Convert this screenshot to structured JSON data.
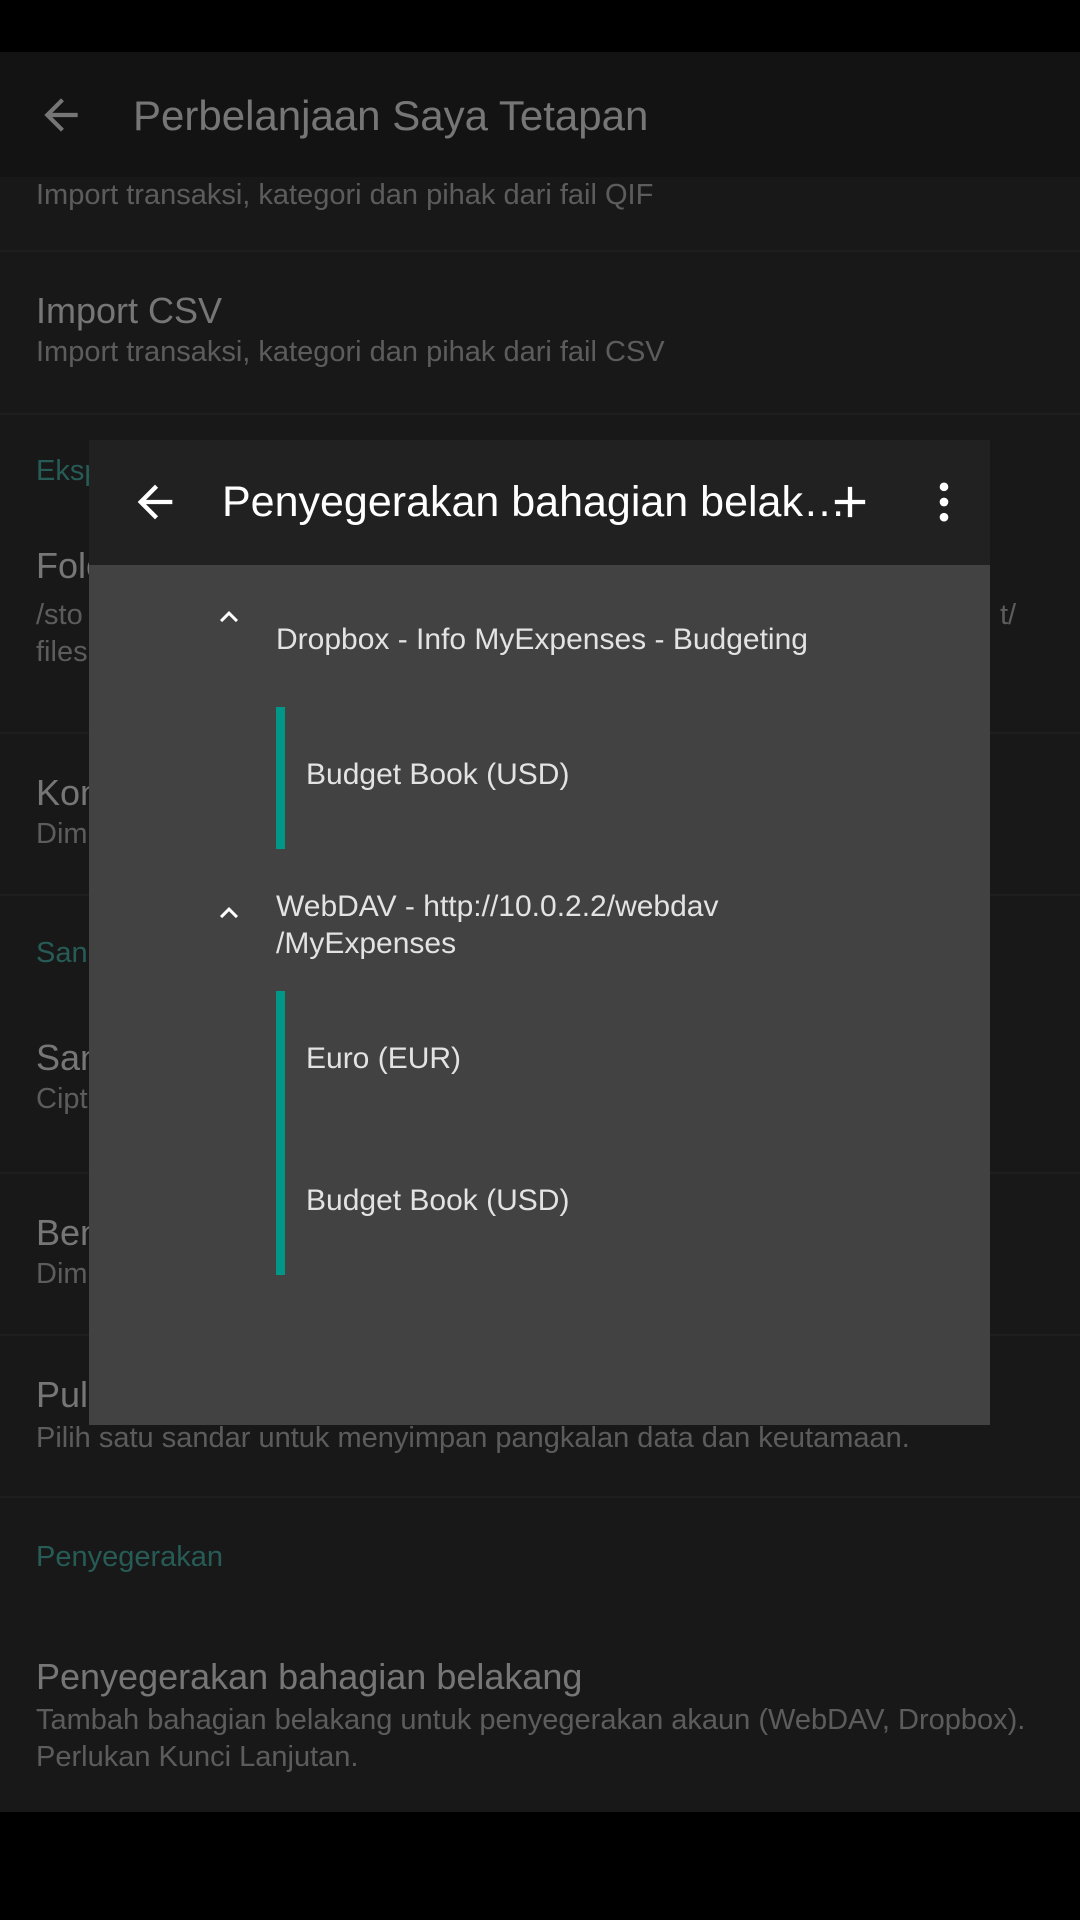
{
  "app_bar": {
    "title": "Perbelanjaan Saya Tetapan"
  },
  "settings": {
    "qif_summary": "Import transaksi, kategori dan pihak dari fail QIF",
    "csv_title": "Import CSV",
    "csv_summary": "Import transaksi, kategori dan pihak dari fail CSV",
    "export_category": "Eksp",
    "folder_title": "Folo",
    "folder_summary_line1": "/sto",
    "folder_summary_line2": "files",
    "folder_summary_right": "t/",
    "kon_title": "Kon",
    "kon_summary": "Dim",
    "san_category": "San",
    "san_title": "San",
    "san_summary": "Cipt",
    "ben_title": "Ben",
    "ben_summary": "Dim",
    "pul_title": "Pul",
    "pul_summary": "Pilih satu sandar untuk menyimpan pangkalan data dan keutamaan.",
    "sync_category": "Penyegerakan",
    "sync_title": "Penyegerakan bahagian belakang",
    "sync_summary": "Tambah bahagian belakang untuk penyegerakan akaun (WebDAV, Dropbox). Perlukan Kunci Lanjutan."
  },
  "dialog": {
    "title": "Penyegerakan bahagian belakang",
    "groups": [
      {
        "label": "Dropbox - Info MyExpenses - Budgeting",
        "children": [
          "Budget Book (USD)"
        ]
      },
      {
        "label": "WebDAV - http://10.0.2.2/webdav /MyExpenses",
        "children": [
          "Euro (EUR)",
          "Budget Book (USD)"
        ]
      }
    ]
  },
  "icons": {
    "back": "arrow-left-icon",
    "add": "plus-icon",
    "more": "more-vert-icon",
    "expand": "chevron-up-icon"
  },
  "colors": {
    "accent": "#009688",
    "category": "#4db6ac",
    "dialog_bg": "#424242",
    "dialog_bar": "#212121"
  }
}
